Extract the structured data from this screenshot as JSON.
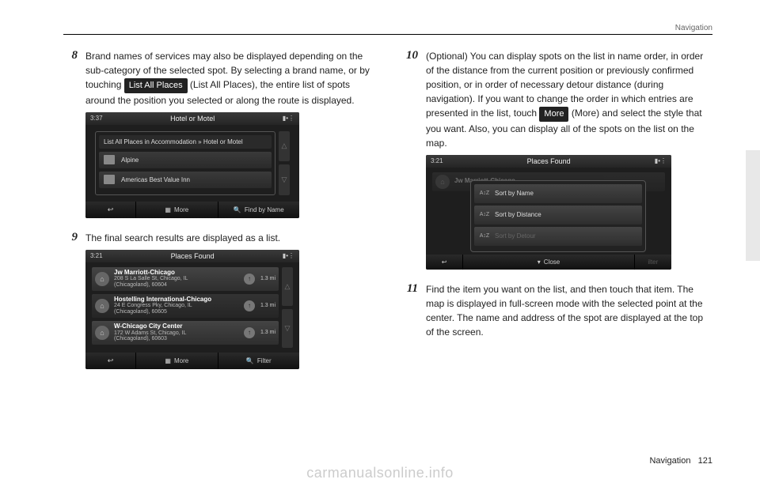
{
  "header": {
    "section": "Navigation"
  },
  "footer": {
    "section": "Navigation",
    "page": "121"
  },
  "watermark": "carmanualsonline.info",
  "steps": {
    "s8": {
      "num": "8",
      "text_before": "Brand names of services may also be displayed depending on the sub-category of the selected spot. By selecting a brand name, or by touching ",
      "chip": "List All Places",
      "text_after": " (List All Places), the entire list of spots around the position you selected or along the route is displayed."
    },
    "s9": {
      "num": "9",
      "text": "The final search results are displayed as a list."
    },
    "s10": {
      "num": "10",
      "text_before": "(Optional) You can display spots on the list in name order, in order of the distance from the current position or previously confirmed position, or in order of necessary detour distance (during navigation). If you want to change the order in which entries are presented in the list, touch ",
      "chip": "More",
      "text_after": " (More) and select the style that you want. Also, you can display all of the spots on the list on the map."
    },
    "s11": {
      "num": "11",
      "text": "Find the item you want on the list, and then touch that item. The map is displayed in full-screen mode with the selected point at the center. The name and address of the spot are displayed at the top of the screen."
    }
  },
  "screenA": {
    "time": "3:37",
    "title": "Hotel or Motel",
    "header_row": "List All Places in Accommodation » Hotel or Motel",
    "rows": [
      "Alpine",
      "Americas Best Value Inn"
    ],
    "bottom": {
      "back": "↩",
      "more": "More",
      "find": "Find by Name"
    }
  },
  "screenB": {
    "time": "3:21",
    "title": "Places Found",
    "rows": [
      {
        "name": "Jw Marriott-Chicago",
        "addr": "208 S La Salle St, Chicago, IL",
        "city": "(Chicagoland), 60604",
        "dist": "1.3 mi"
      },
      {
        "name": "Hostelling International-Chicago",
        "addr": "24 E Congress Pky, Chicago, IL",
        "city": "(Chicagoland), 60605",
        "dist": "1.3 mi"
      },
      {
        "name": "W-Chicago City Center",
        "addr": "172 W Adams St, Chicago, IL",
        "city": "(Chicagoland), 60603",
        "dist": "1.3 mi"
      }
    ],
    "bottom": {
      "back": "↩",
      "more": "More",
      "filter": "Filter"
    }
  },
  "screenC": {
    "time": "3:21",
    "title": "Places Found",
    "bg_name": "Jw Marriott-Chicago",
    "popup": {
      "sort_name": "Sort by Name",
      "sort_dist": "Sort by Distance",
      "sort_detour": "Sort by Detour",
      "close": "Close"
    },
    "bottom_right": "ilter"
  }
}
